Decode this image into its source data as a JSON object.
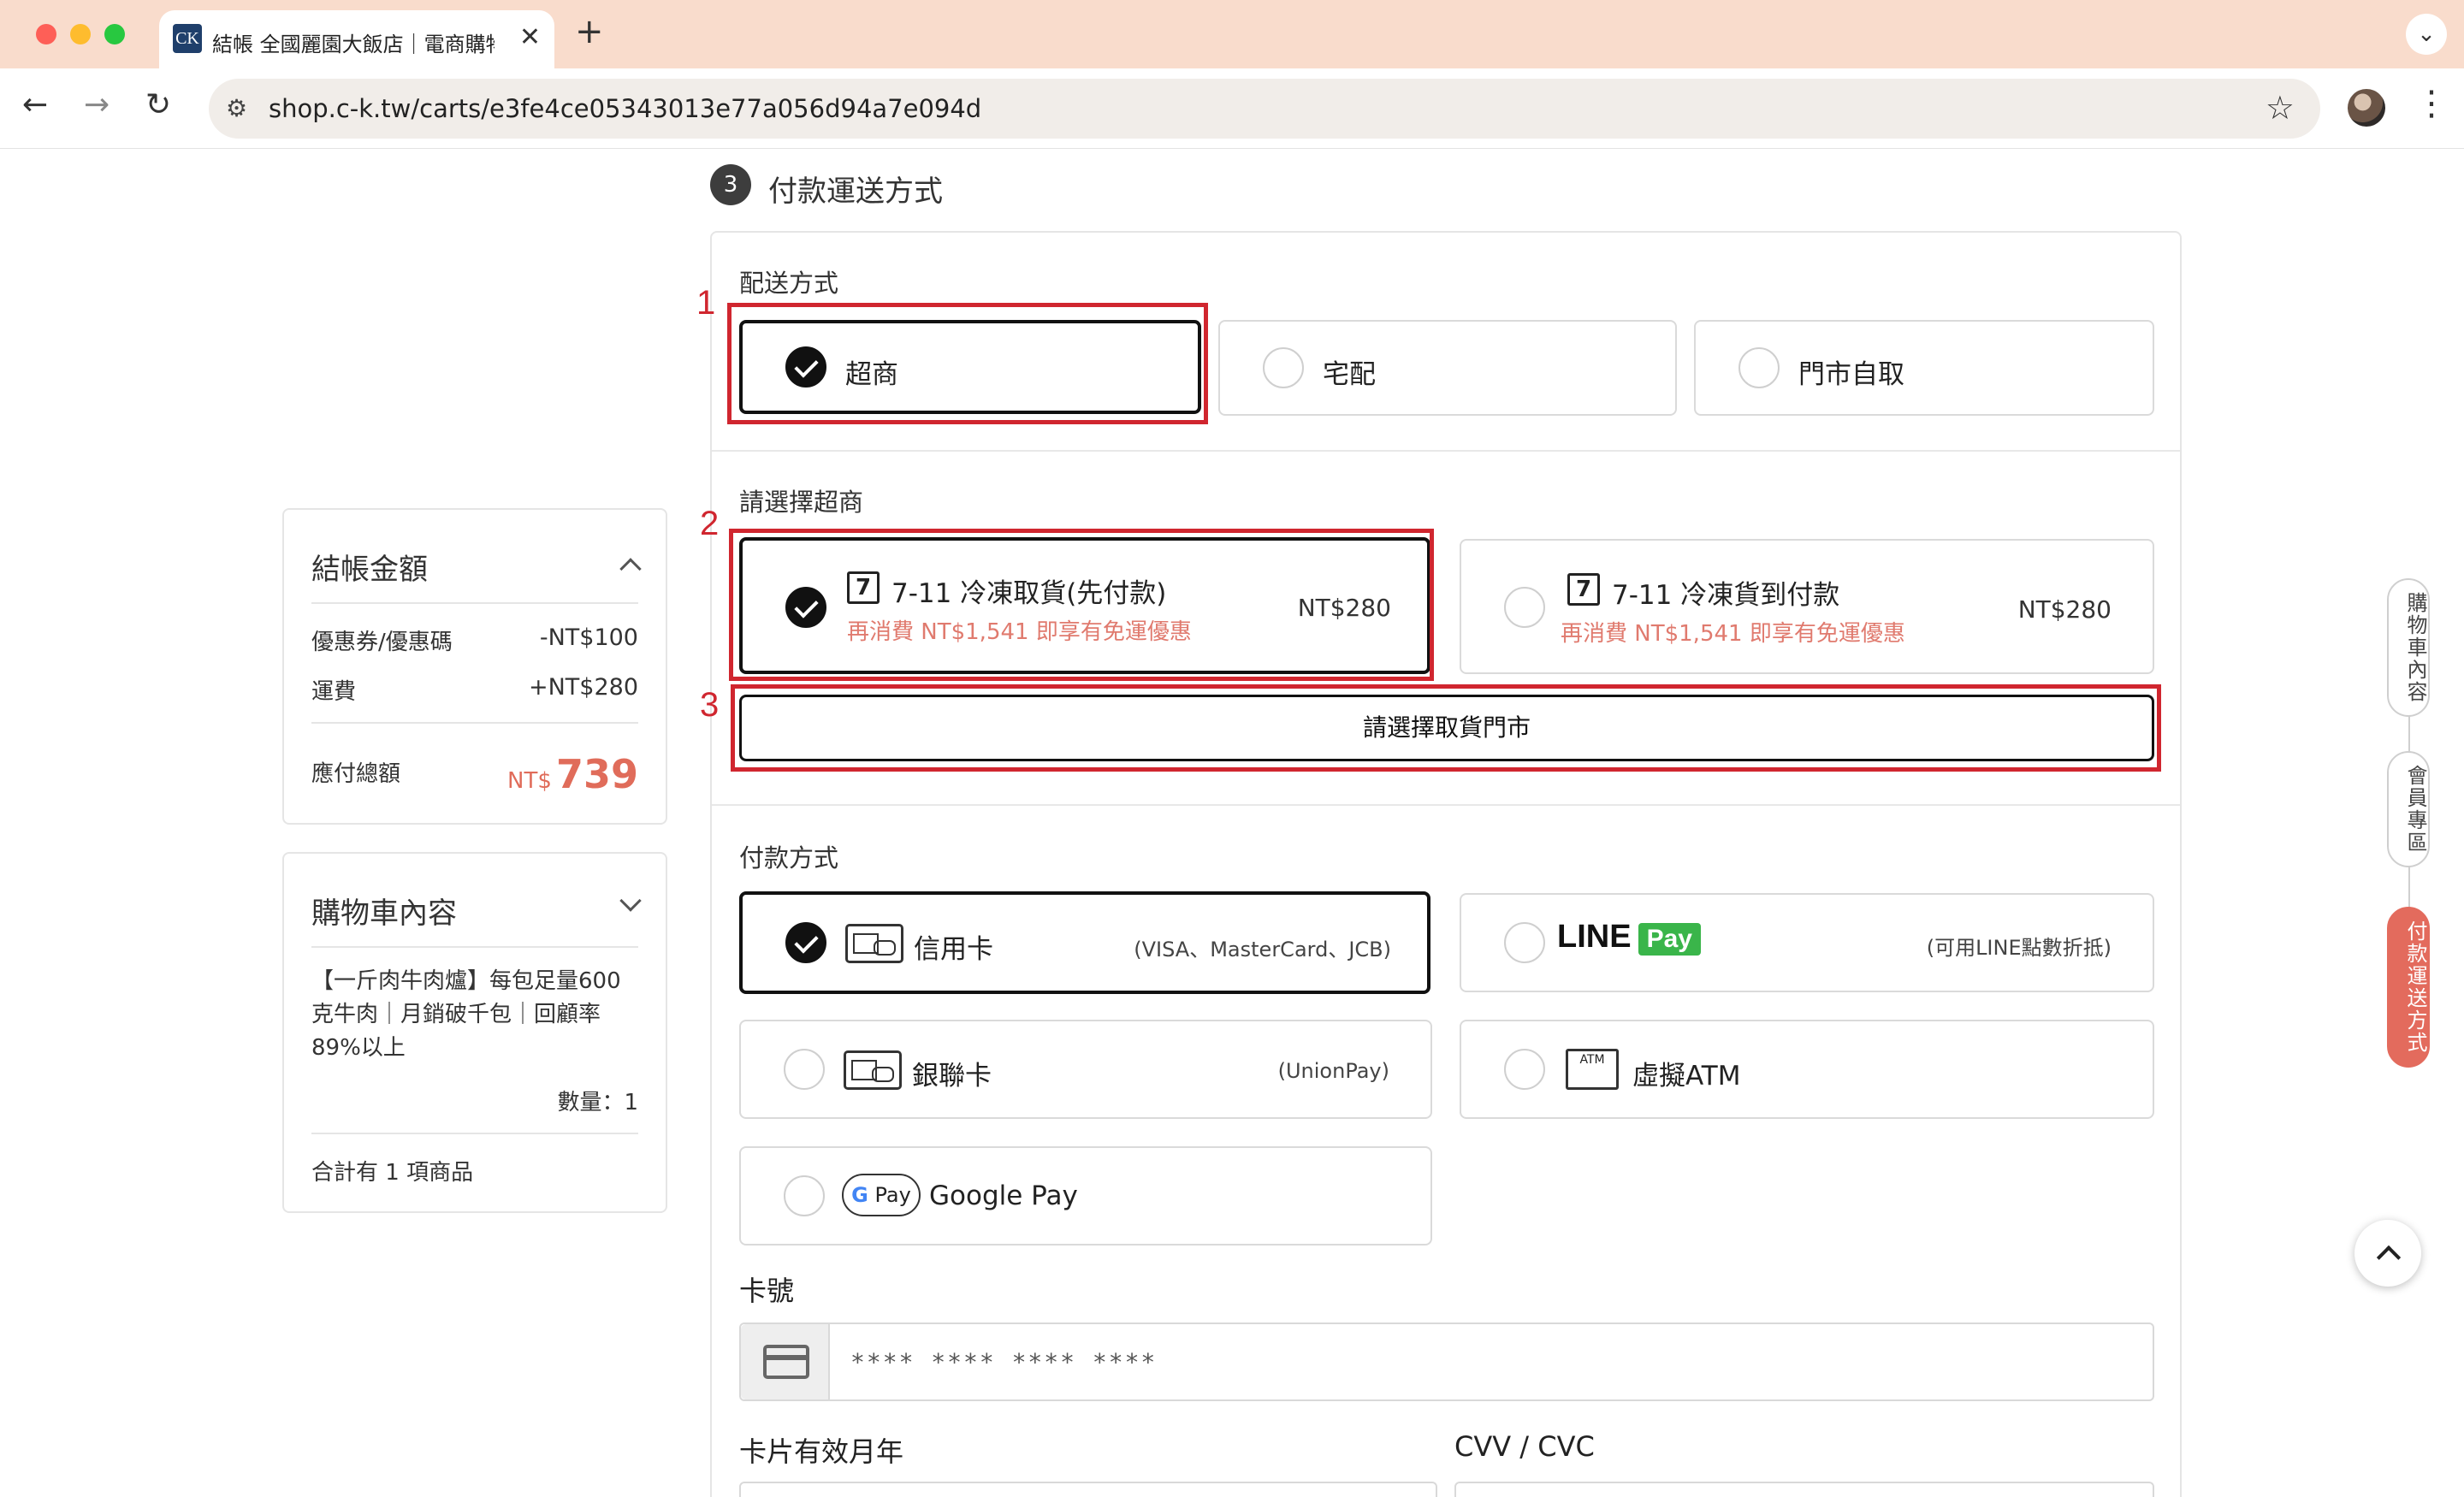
{
  "browser": {
    "tab_title": "結帳 全國麗園大飯店｜電商購物",
    "tab_favicon": "CK",
    "url": "shop.c-k.tw/carts/e3fe4ce05343013e77a056d94a7e094d",
    "icons": [
      "back-arrow-icon",
      "forward-arrow-icon",
      "reload-icon",
      "site-info-icon",
      "star-icon",
      "menu-dots-icon"
    ]
  },
  "section": {
    "step": "3",
    "title": "付款運送方式"
  },
  "shipping": {
    "label": "配送方式",
    "options": [
      {
        "label": "超商",
        "selected": true
      },
      {
        "label": "宅配",
        "selected": false
      },
      {
        "label": "門市自取",
        "selected": false
      }
    ]
  },
  "store": {
    "label": "請選擇超商",
    "options": [
      {
        "label": "7-11 冷凍取貨(先付款)",
        "note": "再消費 NT$1,541 即享有免運優惠",
        "price": "NT$280",
        "selected": true
      },
      {
        "label": "7-11 冷凍貨到付款",
        "note": "再消費 NT$1,541 即享有免運優惠",
        "price": "NT$280",
        "selected": false
      }
    ],
    "pick_store_button": "請選擇取貨門市"
  },
  "annotations": [
    "1",
    "2",
    "3"
  ],
  "payment": {
    "label": "付款方式",
    "credit_card": {
      "label": "信用卡",
      "note": "(VISA、MasterCard、JCB)",
      "selected": true
    },
    "line_pay": {
      "line": "LINE",
      "pay": "Pay",
      "note": "(可用LINE點數折抵)",
      "selected": false
    },
    "union_pay": {
      "label": "銀聯卡",
      "note": "(UnionPay)",
      "selected": false
    },
    "atm": {
      "label": "虛擬ATM",
      "icon_text": "ATM",
      "selected": false
    },
    "google_pay": {
      "label": "Google Pay",
      "badge_g": "G",
      "badge_pay": "Pay",
      "selected": false
    }
  },
  "card_form": {
    "card_number_label": "卡號",
    "card_number_placeholder": "**** **** **** ****",
    "expiry_label": "卡片有效月年",
    "cvv_label": "CVV / CVC"
  },
  "summary": {
    "title": "結帳金額",
    "coupon_label": "優惠券/優惠碼",
    "coupon_value": "-NT$100",
    "shipping_label": "運費",
    "shipping_value": "+NT$280",
    "total_label": "應付總額",
    "total_currency": "NT$",
    "total_amount": "739"
  },
  "cart": {
    "title": "購物車內容",
    "item_name": "【一斤肉牛肉爐】每包足量600克牛肉｜月銷破千包｜回顧率89%以上",
    "quantity": "數量：1",
    "item_count": "合計有 1 項商品"
  },
  "side_nav": {
    "items": [
      "購物車內容",
      "會員專區",
      "付款運送方式"
    ],
    "active_index": 2
  }
}
